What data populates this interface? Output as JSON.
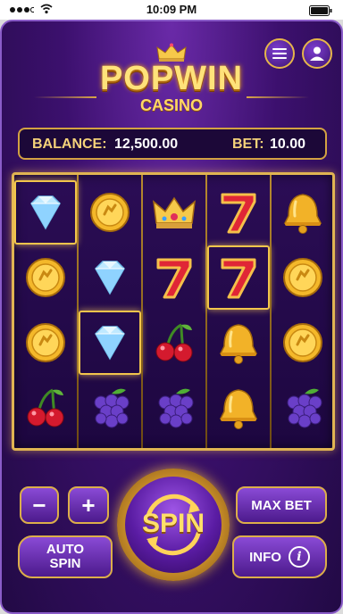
{
  "status_bar": {
    "time": "10:09 PM"
  },
  "header": {
    "logo_title": "POPWIN",
    "logo_subtitle": "CASINO",
    "menu_icon": "hamburger-icon",
    "profile_icon": "user-icon"
  },
  "info_bar": {
    "balance_label": "BALANCE:",
    "balance_value": "12,500.00",
    "bet_label": "BET:",
    "bet_value": "10.00"
  },
  "reels": [
    [
      "diamond",
      "coin",
      "coin",
      "cherry"
    ],
    [
      "coin",
      "diamond",
      "diamond",
      "grape"
    ],
    [
      "crown",
      "seven",
      "cherry",
      "grape"
    ],
    [
      "seven",
      "seven",
      "bell",
      "bell"
    ],
    [
      "bell",
      "coin",
      "coin",
      "grape"
    ]
  ],
  "highlighted_cells": [
    [
      0,
      0
    ],
    [
      1,
      2
    ],
    [
      3,
      1
    ]
  ],
  "controls": {
    "minus_label": "−",
    "plus_label": "+",
    "auto_spin_label_1": "AUTO",
    "auto_spin_label_2": "SPIN",
    "spin_label": "SPIN",
    "max_bet_label": "MAX BET",
    "info_label": "INFO",
    "info_icon": "i"
  },
  "colors": {
    "accent_gold": "#e0b452",
    "background_purple": "#3c106e"
  }
}
